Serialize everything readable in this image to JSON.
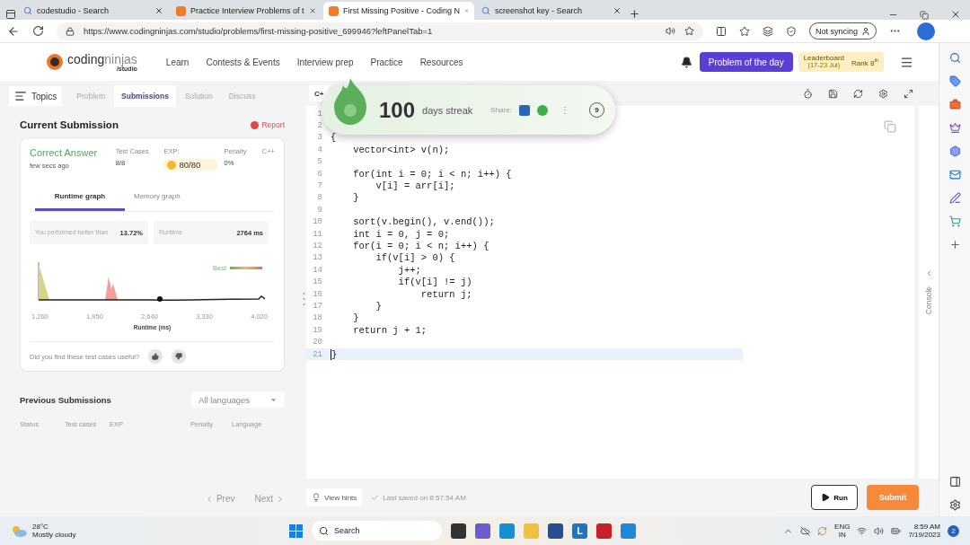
{
  "browser": {
    "tabs": [
      {
        "kind": "search",
        "title": "codestudio - Search",
        "selected": false
      },
      {
        "kind": "site",
        "title": "Practice Interview Problems of t",
        "selected": false
      },
      {
        "kind": "site",
        "title": "First Missing Positive - Coding N",
        "selected": true
      },
      {
        "kind": "search",
        "title": "screenshot key - Search",
        "selected": false
      }
    ],
    "url": "https://www.codingninjas.com/studio/problems/first-missing-positive_699946?leftPanelTab=1",
    "sync_label": "Not syncing"
  },
  "header": {
    "logo": {
      "name_a": "coding",
      "name_b": "ninjas",
      "sub": "/studio"
    },
    "nav": [
      "Learn",
      "Contests & Events",
      "Interview prep",
      "Practice",
      "Resources"
    ],
    "potd": "Problem of the day",
    "leaderboard": {
      "label": "Leaderboard",
      "dates": "(17-23 Jul)",
      "rank": "Rank 8$^{th}$"
    }
  },
  "left_panel": {
    "topics": "Topics",
    "tabs": [
      {
        "label": "Problem",
        "selected": false
      },
      {
        "label": "Submissions",
        "selected": true
      },
      {
        "label": "Solution",
        "selected": false
      },
      {
        "label": "Discuss",
        "selected": false
      }
    ],
    "title": "Current Submission",
    "report": "Report",
    "result": {
      "status": "Correct Answer",
      "time": "few secs ago",
      "test_cases_label": "Test Cases",
      "test_cases": "8/8",
      "exp_label": "EXP:",
      "exp": "80/80",
      "penalty_label": "Penalty",
      "penalty": "0%",
      "language": "C++"
    },
    "graph_tabs": [
      {
        "label": "Runtime graph",
        "selected": true
      },
      {
        "label": "Memory graph",
        "selected": false
      }
    ],
    "stats": [
      {
        "label": "You performed better than",
        "value": "13.72%"
      },
      {
        "label": "Runtime",
        "value": "2764 ms"
      }
    ],
    "graph": {
      "legend": "Best",
      "ticks": [
        "1,260",
        "1,950",
        "2,640",
        "3,330",
        "4,020"
      ],
      "axis_label": "Runtime (ms)"
    },
    "feedback": "Did you find these test cases useful?",
    "previous": {
      "title": "Previous Submissions",
      "filter": "All languages",
      "columns": [
        "Status",
        "Test cases",
        "EXP",
        "Penalty",
        "Language"
      ]
    },
    "pager": {
      "prev": "Prev",
      "next": "Next"
    }
  },
  "editor": {
    "language": "C+",
    "lines": [
      {
        "n": "1",
        "current": false
      },
      {
        "n": "2",
        "current": false
      },
      {
        "n": "3",
        "code": "{",
        "current": false
      },
      {
        "n": "4",
        "code": "    vector<int> v(n);",
        "current": false
      },
      {
        "n": "5",
        "current": false
      },
      {
        "n": "6",
        "code": "    for(int i = 0; i < n; i++) {",
        "current": false
      },
      {
        "n": "7",
        "code": "        v[i] = arr[i];",
        "current": false
      },
      {
        "n": "8",
        "code": "    }",
        "current": false
      },
      {
        "n": "9",
        "current": false
      },
      {
        "n": "10",
        "code": "    sort(v.begin(), v.end());",
        "current": false
      },
      {
        "n": "11",
        "code": "    int i = 0, j = 0;",
        "current": false
      },
      {
        "n": "12",
        "code": "    for(i = 0; i < n; i++) {",
        "current": false
      },
      {
        "n": "13",
        "code": "        if(v[i] > 0) {",
        "current": false
      },
      {
        "n": "14",
        "code": "            j++;",
        "current": false
      },
      {
        "n": "15",
        "code": "            if(v[i] != j)",
        "current": false
      },
      {
        "n": "16",
        "code": "                return j;",
        "current": false
      },
      {
        "n": "17",
        "code": "        }",
        "current": false
      },
      {
        "n": "18",
        "code": "    }",
        "current": false
      },
      {
        "n": "19",
        "code": "    return j + 1;",
        "current": false
      },
      {
        "n": "20",
        "current": false
      },
      {
        "n": "21",
        "code": "}",
        "current": true
      }
    ],
    "console": "Console",
    "hints": "View hints",
    "saved": "Last saved on 8:57:54 AM",
    "run": "Run",
    "submit": "Submit"
  },
  "streak": {
    "count": "100",
    "label": "days streak",
    "share": "Share:",
    "more": "⋮",
    "badge": "9"
  },
  "taskbar": {
    "temp": "28°C",
    "weather": "Mostly cloudy",
    "search": "Search",
    "app_letter": "L",
    "lang": "ENG",
    "region": "IN",
    "time": "8:59 AM",
    "date": "7/19/2023",
    "notifications": "2"
  }
}
